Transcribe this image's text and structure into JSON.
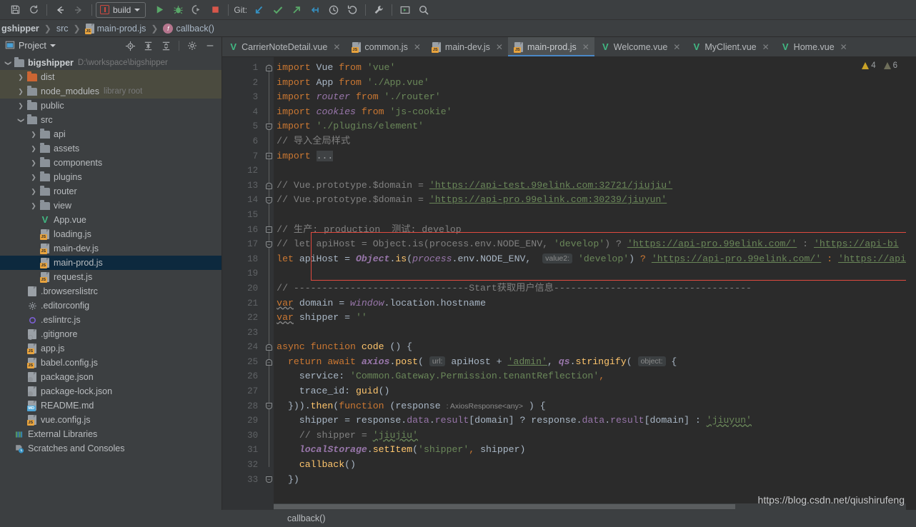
{
  "toolbar": {
    "icons": [
      {
        "name": "save-icon",
        "glyph": "save"
      },
      {
        "name": "sync-icon",
        "glyph": "sync"
      },
      {
        "name": "back-arrow-icon",
        "glyph": "back"
      },
      {
        "name": "forward-arrow-icon",
        "glyph": "forward"
      }
    ],
    "run_config": {
      "label": "build"
    },
    "run_icons": [
      {
        "name": "run-icon"
      },
      {
        "name": "debug-icon"
      },
      {
        "name": "run-with-coverage-icon"
      },
      {
        "name": "stop-icon"
      }
    ],
    "git_label": "Git:",
    "git_icons": [
      {
        "name": "git-update-project-icon"
      },
      {
        "name": "git-commit-icon"
      },
      {
        "name": "git-push-icon"
      },
      {
        "name": "git-rebase-icon"
      },
      {
        "name": "git-history-icon"
      },
      {
        "name": "git-rollback-icon"
      }
    ],
    "tail_icons": [
      {
        "name": "settings-wrench-icon"
      },
      {
        "name": "run-anything-icon"
      },
      {
        "name": "search-everywhere-icon"
      }
    ]
  },
  "breadcrumb": {
    "items": [
      {
        "label": "gshipper",
        "icon": "none",
        "bold": true
      },
      {
        "label": "src",
        "icon": "none",
        "bold": false
      },
      {
        "label": "main-prod.js",
        "icon": "js-file-icon",
        "bold": false
      },
      {
        "label": "callback()",
        "icon": "function-icon",
        "bold": false
      }
    ]
  },
  "project_panel": {
    "title": "Project",
    "header_icons": [
      {
        "name": "locate-target-icon"
      },
      {
        "name": "expand-all-icon"
      },
      {
        "name": "collapse-all-icon"
      },
      {
        "name": "gear-icon"
      },
      {
        "name": "hide-panel-icon"
      }
    ],
    "tree": [
      {
        "label": "bigshipper",
        "suffix": "D:\\workspace\\bigshipper",
        "indent": 0,
        "arrow": "down",
        "icon": "folder",
        "bold": true,
        "state": "normal"
      },
      {
        "label": "dist",
        "suffix": "",
        "indent": 1,
        "arrow": "right",
        "icon": "folder-orange",
        "bold": false,
        "state": "special"
      },
      {
        "label": "node_modules",
        "suffix": "library root",
        "indent": 1,
        "arrow": "right",
        "icon": "folder",
        "bold": false,
        "state": "special"
      },
      {
        "label": "public",
        "suffix": "",
        "indent": 1,
        "arrow": "right",
        "icon": "folder",
        "bold": false,
        "state": "normal"
      },
      {
        "label": "src",
        "suffix": "",
        "indent": 1,
        "arrow": "down",
        "icon": "folder",
        "bold": false,
        "state": "normal"
      },
      {
        "label": "api",
        "suffix": "",
        "indent": 2,
        "arrow": "right",
        "icon": "folder",
        "bold": false,
        "state": "normal"
      },
      {
        "label": "assets",
        "suffix": "",
        "indent": 2,
        "arrow": "right",
        "icon": "folder",
        "bold": false,
        "state": "normal"
      },
      {
        "label": "components",
        "suffix": "",
        "indent": 2,
        "arrow": "right",
        "icon": "folder",
        "bold": false,
        "state": "normal"
      },
      {
        "label": "plugins",
        "suffix": "",
        "indent": 2,
        "arrow": "right",
        "icon": "folder",
        "bold": false,
        "state": "normal"
      },
      {
        "label": "router",
        "suffix": "",
        "indent": 2,
        "arrow": "right",
        "icon": "folder",
        "bold": false,
        "state": "normal"
      },
      {
        "label": "view",
        "suffix": "",
        "indent": 2,
        "arrow": "right",
        "icon": "folder",
        "bold": false,
        "state": "normal"
      },
      {
        "label": "App.vue",
        "suffix": "",
        "indent": 2,
        "arrow": "",
        "icon": "vue-file-icon",
        "bold": false,
        "state": "normal"
      },
      {
        "label": "loading.js",
        "suffix": "",
        "indent": 2,
        "arrow": "",
        "icon": "js-file-icon",
        "bold": false,
        "state": "normal"
      },
      {
        "label": "main-dev.js",
        "suffix": "",
        "indent": 2,
        "arrow": "",
        "icon": "js-file-icon",
        "bold": false,
        "state": "normal"
      },
      {
        "label": "main-prod.js",
        "suffix": "",
        "indent": 2,
        "arrow": "",
        "icon": "js-file-icon",
        "bold": false,
        "state": "selected"
      },
      {
        "label": "request.js",
        "suffix": "",
        "indent": 2,
        "arrow": "",
        "icon": "js-file-icon",
        "bold": false,
        "state": "normal"
      },
      {
        "label": ".browserslistrc",
        "suffix": "",
        "indent": 1,
        "arrow": "",
        "icon": "text-file-icon",
        "bold": false,
        "state": "normal"
      },
      {
        "label": ".editorconfig",
        "suffix": "",
        "indent": 1,
        "arrow": "",
        "icon": "gear-file-icon",
        "bold": false,
        "state": "normal"
      },
      {
        "label": ".eslintrc.js",
        "suffix": "",
        "indent": 1,
        "arrow": "",
        "icon": "eslint-file-icon",
        "bold": false,
        "state": "normal"
      },
      {
        "label": ".gitignore",
        "suffix": "",
        "indent": 1,
        "arrow": "",
        "icon": "ignored-file-icon",
        "bold": false,
        "state": "normal"
      },
      {
        "label": "app.js",
        "suffix": "",
        "indent": 1,
        "arrow": "",
        "icon": "js-file-icon",
        "bold": false,
        "state": "normal"
      },
      {
        "label": "babel.config.js",
        "suffix": "",
        "indent": 1,
        "arrow": "",
        "icon": "js-file-icon",
        "bold": false,
        "state": "normal"
      },
      {
        "label": "package.json",
        "suffix": "",
        "indent": 1,
        "arrow": "",
        "icon": "json-file-icon",
        "bold": false,
        "state": "normal"
      },
      {
        "label": "package-lock.json",
        "suffix": "",
        "indent": 1,
        "arrow": "",
        "icon": "json-file-icon",
        "bold": false,
        "state": "normal"
      },
      {
        "label": "README.md",
        "suffix": "",
        "indent": 1,
        "arrow": "",
        "icon": "md-file-icon",
        "bold": false,
        "state": "normal"
      },
      {
        "label": "vue.config.js",
        "suffix": "",
        "indent": 1,
        "arrow": "",
        "icon": "js-file-icon",
        "bold": false,
        "state": "normal"
      },
      {
        "label": "External Libraries",
        "suffix": "",
        "indent": 0,
        "arrow": "",
        "icon": "libraries-icon",
        "bold": false,
        "state": "normal"
      },
      {
        "label": "Scratches and Consoles",
        "suffix": "",
        "indent": 0,
        "arrow": "",
        "icon": "scratches-icon",
        "bold": false,
        "state": "normal"
      }
    ]
  },
  "editor": {
    "tabs": [
      {
        "label": "CarrierNoteDetail.vue",
        "icon": "vue-file-icon",
        "active": false
      },
      {
        "label": "common.js",
        "icon": "js-file-icon",
        "active": false
      },
      {
        "label": "main-dev.js",
        "icon": "js-file-icon",
        "active": false
      },
      {
        "label": "main-prod.js",
        "icon": "js-file-icon",
        "active": true
      },
      {
        "label": "Welcome.vue",
        "icon": "vue-file-icon",
        "active": false
      },
      {
        "label": "MyClient.vue",
        "icon": "vue-file-icon",
        "active": false
      },
      {
        "label": "Home.vue",
        "icon": "vue-file-icon",
        "active": false
      }
    ],
    "tab_close_glyph": "✕",
    "inspection": {
      "warning_count": "4",
      "weak_warning_count": "6"
    },
    "line_numbers": [
      "1",
      "2",
      "3",
      "4",
      "5",
      "6",
      "7",
      "12",
      "13",
      "14",
      "15",
      "16",
      "17",
      "18",
      "19",
      "20",
      "21",
      "22",
      "23",
      "24",
      "25",
      "26",
      "27",
      "28",
      "29",
      "30",
      "31",
      "32",
      "33"
    ],
    "lines": [
      "import Vue from 'vue'",
      "import App from './App.vue'",
      "import router from './router'",
      "import cookies from 'js-cookie'",
      "import './plugins/element'",
      "// 导入全局样式",
      "import ...",
      "",
      "// Vue.prototype.$domain = 'https://api-test.99elink.com:32721/jiujiu'",
      "// Vue.prototype.$domain = 'https://api-pro.99elink.com:30239/jiuyun'",
      "",
      "// 生产: production  测试: develop",
      "// let apiHost = Object.is(process.env.NODE_ENV, 'develop') ? 'https://api-pro.99elink.com/' : 'https://api-bi",
      "let apiHost = Object.is(process.env.NODE_ENV,  value2: 'develop') ? 'https://api-pro.99elink.com/' : 'https://api",
      "",
      "// -------------------------------Start获取用户信息-----------------------------------",
      "var domain = window.location.hostname",
      "var shipper = ''",
      "",
      "async function code () {",
      "  return await axios.post( url: apiHost + 'admin', qs.stringify( object: {",
      "    service: 'Common.Gateway.Permission.tenantReflection',",
      "    trace_id: guid()",
      "  })).then(function (response : AxiosResponse<any> ) {",
      "    shipper = response.data.result[domain] ? response.data.result[domain] : 'jiuyun'",
      "    // shipper = 'jiujiu'",
      "    localStorage.setItem('shipper', shipper)",
      "    callback()",
      "  })"
    ],
    "inlay_hints": [
      "value2:",
      "url:",
      "object:",
      ": AxiosResponse<any>"
    ],
    "highlight_box": {
      "color": "#e04a3f",
      "lines": "17-19"
    },
    "status_text": "callback()"
  },
  "watermark": {
    "text": "https://blog.csdn.net/qiushirufeng"
  },
  "colors": {
    "background": "#2b2b2b",
    "panel": "#3c3f41",
    "selection": "#0d293e",
    "accent": "#4a88c7",
    "keyword": "#cc7832",
    "string": "#6a8759",
    "comment": "#808080",
    "function": "#ffc66d",
    "field": "#9876aa",
    "highlight": "#e04a3f"
  }
}
